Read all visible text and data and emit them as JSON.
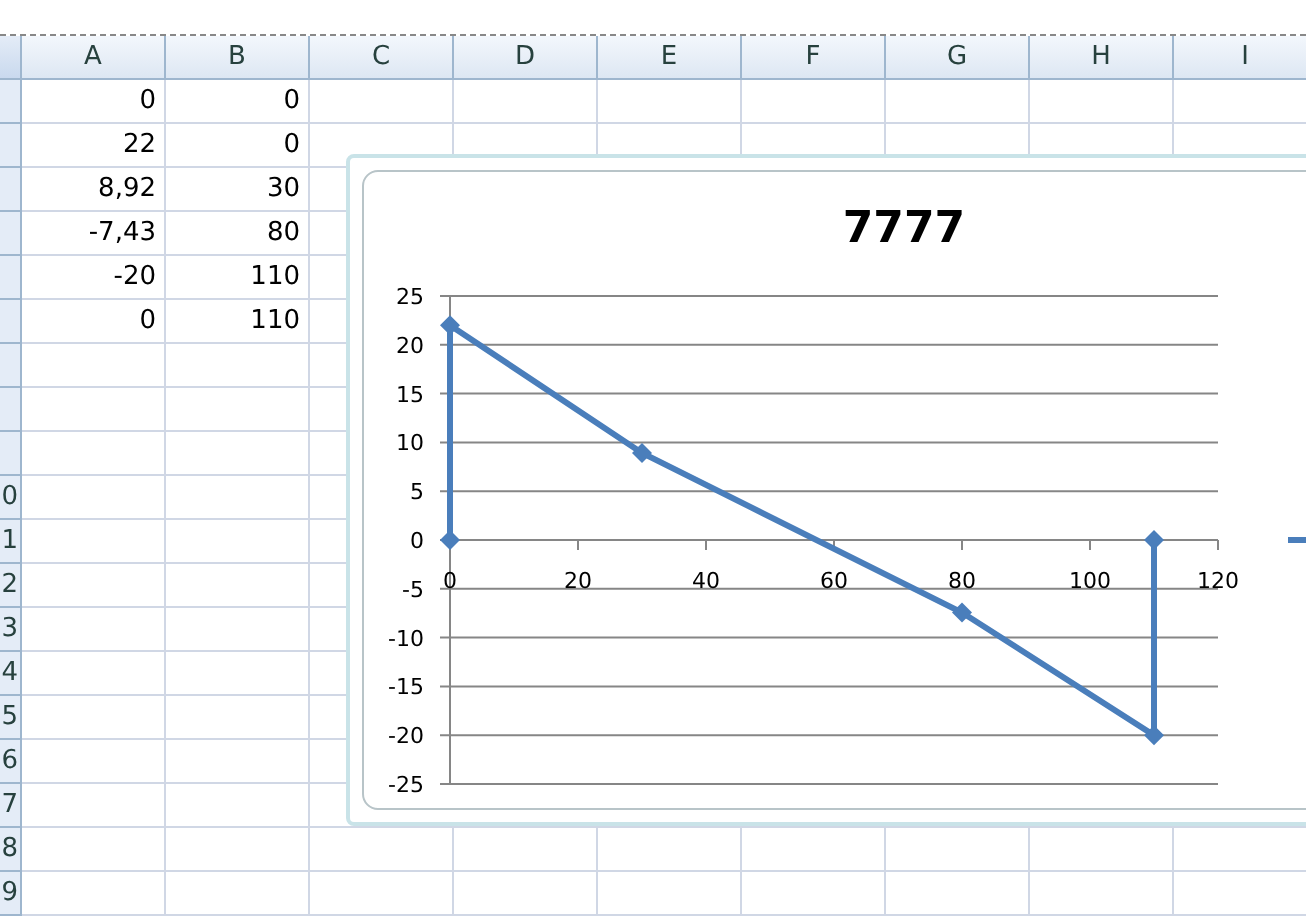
{
  "sheet": {
    "columns": [
      "A",
      "B",
      "C",
      "D",
      "E",
      "F",
      "G",
      "H",
      "I"
    ],
    "rows": [
      {
        "cells": [
          "0",
          "0"
        ]
      },
      {
        "cells": [
          "22",
          "0"
        ]
      },
      {
        "cells": [
          "8,92",
          "30"
        ]
      },
      {
        "cells": [
          "-7,43",
          "80"
        ]
      },
      {
        "cells": [
          "-20",
          "110"
        ]
      },
      {
        "cells": [
          "0",
          "110"
        ]
      },
      {
        "cells": []
      },
      {
        "cells": []
      },
      {
        "cells": []
      },
      {
        "header": "0",
        "cells": []
      },
      {
        "header": "1",
        "cells": []
      },
      {
        "header": "2",
        "cells": []
      },
      {
        "header": "3",
        "cells": []
      },
      {
        "header": "4",
        "cells": []
      },
      {
        "header": "5",
        "cells": []
      },
      {
        "header": "6",
        "cells": []
      },
      {
        "header": "7",
        "cells": []
      },
      {
        "header": "8",
        "cells": []
      },
      {
        "header": "9",
        "cells": []
      }
    ]
  },
  "chart": {
    "chart_data": {
      "type": "line",
      "grid": true,
      "title": "7777",
      "x": [
        0,
        0,
        30,
        80,
        110,
        110
      ],
      "series": [
        {
          "color": "#4a7ebb",
          "marker": "diamond",
          "values": [
            0,
            22,
            8.92,
            -7.43,
            -20,
            0
          ]
        }
      ],
      "xlim": [
        0,
        120
      ],
      "ylim": [
        -25,
        25
      ],
      "xticks": [
        0,
        20,
        40,
        60,
        80,
        100,
        120
      ],
      "yticks": [
        -25,
        -20,
        -15,
        -10,
        -5,
        0,
        5,
        10,
        15,
        20,
        25
      ]
    }
  }
}
